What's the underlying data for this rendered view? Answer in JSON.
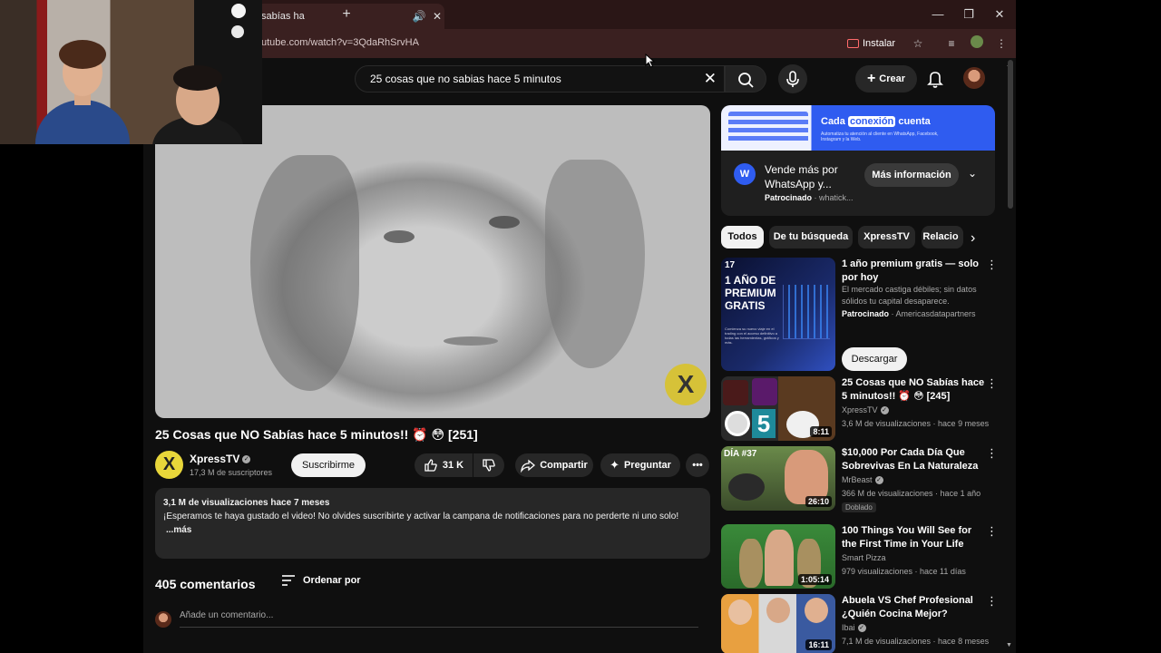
{
  "browser": {
    "tab_title": "sabías ha",
    "url": "utube.com/watch?v=3QdaRhSrvHA",
    "install_label": "Instalar"
  },
  "youtube": {
    "search_query": "25 cosas que no sabias hace 5 minutos",
    "create_label": "Crear"
  },
  "video": {
    "title": "25 Cosas que NO Sabías hace 5 minutos!! ⏰ 😳 [251]",
    "channel": "XpressTV",
    "subscribers": "17,3 M de suscriptores",
    "subscribe_label": "Suscribirme",
    "likes": "31 K",
    "share_label": "Compartir",
    "ask_label": "Preguntar",
    "logo_text": "X"
  },
  "description": {
    "meta": "3,1 M de visualizaciones  hace 7 meses",
    "text": "¡Esperamos te haya gustado el video! No olvides suscribirte y activar la campana de notificaciones para no perderte ni uno solo!",
    "more": "...más"
  },
  "comments": {
    "count": "405 comentarios",
    "sort_label": "Ordenar por",
    "placeholder": "Añade un comentario..."
  },
  "ad": {
    "banner_headline_1": "Cada",
    "banner_headline_highlight": "conexión",
    "banner_headline_2": "cuenta",
    "banner_sub": "Automatiza tu atención al cliente en WhatsApp, Facebook, Instagram y la Web.",
    "title": "Vende más por WhatsApp y...",
    "sponsored": "Patrocinado",
    "advertiser": " · whatick...",
    "cta": "Más información"
  },
  "chips": [
    "Todos",
    "De tu búsqueda",
    "XpressTV",
    "Relacio"
  ],
  "recommendations": [
    {
      "title": "1 año premium gratis — solo por hoy",
      "line1": "El mercado castiga débiles; sin datos sólidos tu capital desaparece.",
      "sponsored": "Patrocinado",
      "advertiser": " · Americasdatapartners",
      "cta": "Descargar",
      "thumb_text": "1 AÑO DE PREMIUM GRATIS",
      "thumb_sub": "Comienza su nuevo viaje en el trading con el acceso definitivo a todas las herramientas, gráficos y más.",
      "thumb_logo": "17"
    },
    {
      "title": "25 Cosas que NO Sabías hace 5 minutos!! ⏰ 😳 [245]",
      "channel": "XpressTV",
      "meta": "3,6 M de visualizaciones · hace 9 meses",
      "duration": "8:11",
      "thumb_text": "5"
    },
    {
      "title": "$10,000 Por Cada Día Que Sobrevivas En La Naturaleza",
      "channel": "MrBeast",
      "meta": "366 M de visualizaciones · hace 1 año",
      "badge": "Doblado",
      "duration": "26:10",
      "thumb_text": "DÍA #37"
    },
    {
      "title": "100 Things You Will See for the First Time in Your Life",
      "channel": "Smart Pizza",
      "meta": "979 visualizaciones · hace 11 días",
      "duration": "1:05:14"
    },
    {
      "title": "Abuela VS Chef Profesional ¿Quién Cocina Mejor?",
      "channel": "Ibai",
      "meta": "7,1 M de visualizaciones · hace 8 meses",
      "duration": "16:11"
    }
  ],
  "colors": {
    "browser_frame": "#2a1616",
    "youtube_bg": "#0f0f0f",
    "surface": "#272727",
    "ad_blue": "#2f5cf0",
    "xpress_yellow": "#e8d63a"
  }
}
